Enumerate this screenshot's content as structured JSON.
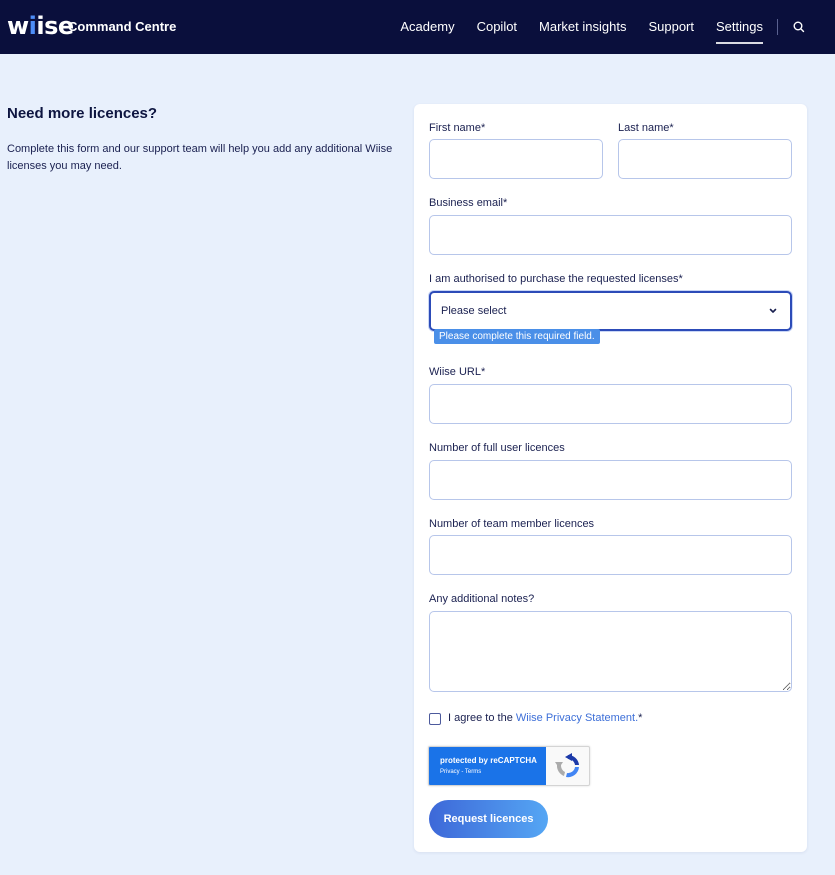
{
  "header": {
    "logo": "wiise",
    "app_title": "Command Centre",
    "nav": [
      {
        "label": "Academy"
      },
      {
        "label": "Copilot"
      },
      {
        "label": "Market insights"
      },
      {
        "label": "Support"
      },
      {
        "label": "Settings",
        "active": true
      }
    ],
    "search_icon": "search-icon"
  },
  "intro": {
    "title": "Need more licences?",
    "text": "Complete this form and our support team will help you add any additional Wiise licenses you may need."
  },
  "form": {
    "first_name": {
      "label": "First name*",
      "value": ""
    },
    "last_name": {
      "label": "Last name*",
      "value": ""
    },
    "business_email": {
      "label": "Business email*",
      "value": ""
    },
    "authorised": {
      "label": "I am authorised to purchase the requested licenses*",
      "selected": "Please select",
      "error": "Please complete this required field."
    },
    "wiise_url": {
      "label": "Wiise URL*",
      "value": ""
    },
    "full_user_licences": {
      "label": "Number of full user licences",
      "value": ""
    },
    "team_member_licences": {
      "label": "Number of team member licences",
      "value": ""
    },
    "notes": {
      "label": "Any additional notes?",
      "value": ""
    },
    "consent": {
      "prefix": "I agree to the ",
      "link": "Wiise Privacy Statement.",
      "suffix": "*",
      "checked": false
    },
    "recaptcha": {
      "title": "protected by reCAPTCHA",
      "links": "Privacy - Terms"
    },
    "submit_label": "Request licences"
  },
  "colors": {
    "topbar": "#0a0f3c",
    "page_bg": "#e8f0fc",
    "accent": "#4d8df7",
    "link": "#3d6fd8",
    "error_tip": "#4a8fe8"
  }
}
